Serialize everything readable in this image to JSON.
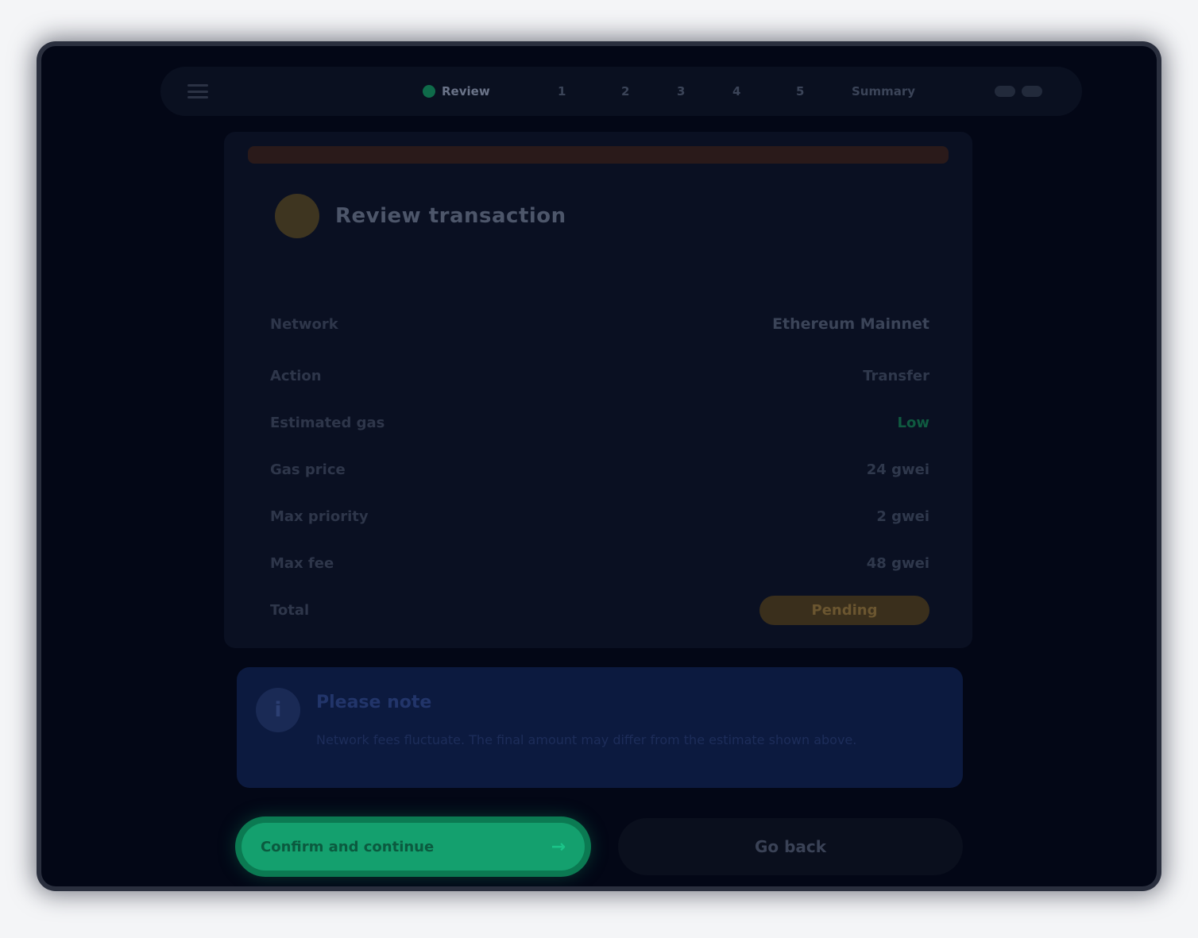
{
  "nav": {
    "steps": [
      {
        "label": "Review",
        "active": true
      },
      {
        "label": "1",
        "active": false
      },
      {
        "label": "2",
        "active": false
      },
      {
        "label": "3",
        "active": false
      },
      {
        "label": "4",
        "active": false
      },
      {
        "label": "5",
        "active": false
      },
      {
        "label": "Summary",
        "active": false
      },
      {
        "label": "",
        "active": false
      }
    ]
  },
  "card": {
    "alert": "",
    "title": "Review transaction",
    "rows": [
      {
        "label": "Network",
        "value": "Ethereum Mainnet"
      },
      {
        "label": "Action",
        "value": "Transfer"
      },
      {
        "label": "Estimated gas",
        "value": "Low"
      },
      {
        "label": "Gas price",
        "value": "24 gwei"
      },
      {
        "label": "Max priority",
        "value": "2 gwei"
      },
      {
        "label": "Max fee",
        "value": "48 gwei"
      },
      {
        "label": "Total",
        "value": "Pending"
      }
    ]
  },
  "info": {
    "icon": "i",
    "title": "Please note",
    "text": "Network fees fluctuate. The final amount may differ from the estimate shown above."
  },
  "buttons": {
    "confirm": "Confirm and continue",
    "confirm_arrow": "→",
    "cancel": "Go back"
  },
  "colors": {
    "accent": "#14a06e",
    "warning": "#3a2f1c",
    "info_bg": "#0c1a3f"
  }
}
